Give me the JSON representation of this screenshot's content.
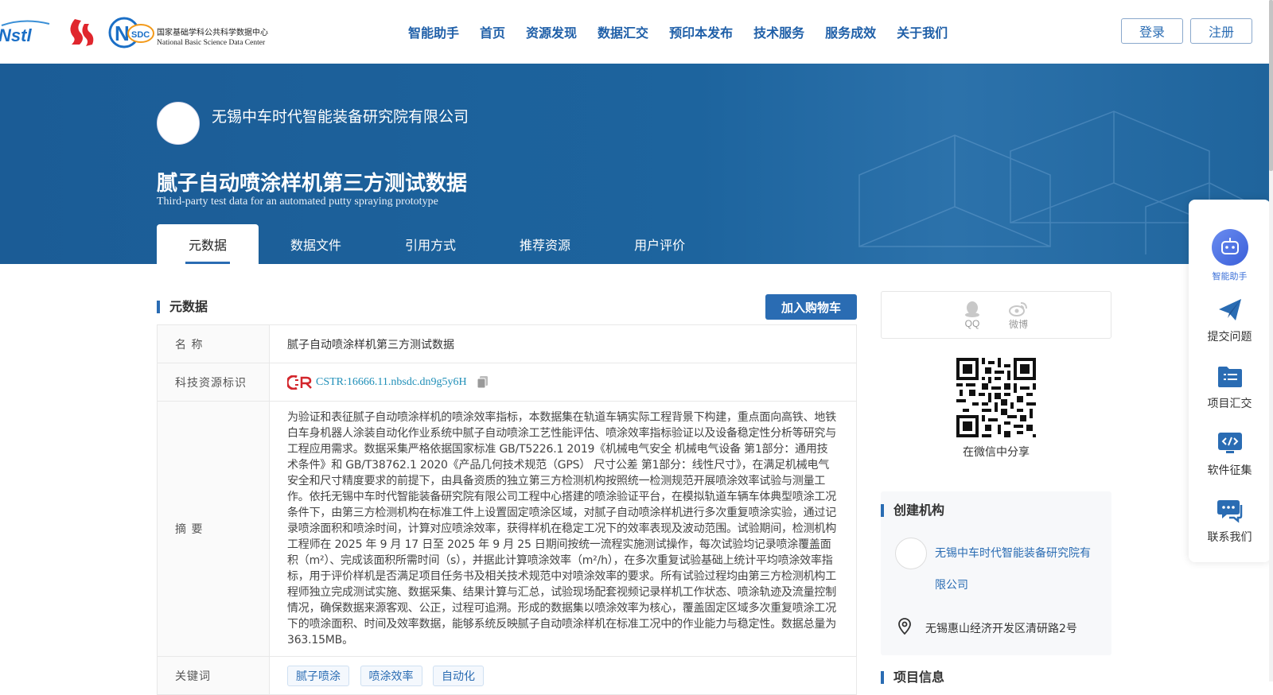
{
  "header": {
    "nav": [
      "智能助手",
      "首页",
      "资源发现",
      "数据汇交",
      "预印本发布",
      "技术服务",
      "服务成效",
      "关于我们"
    ],
    "login_label": "登录",
    "register_label": "注册",
    "logo_text_1": "Nstl",
    "logo_nsdc_cn": "国家基础学科公共科学数据中心",
    "logo_nsdc_en": "National Basic Science Data Center"
  },
  "hero": {
    "org_name": "无锡中车时代智能装备研究院有限公司",
    "title_cn": "腻子自动喷涂样机第三方测试数据",
    "title_en": "Third-party test data for an automated putty spraying prototype",
    "tabs": [
      "元数据",
      "数据文件",
      "引用方式",
      "推荐资源",
      "用户评价"
    ],
    "active_tab": "元数据"
  },
  "metadata": {
    "section_title": "元数据",
    "cart_label": "加入购物车",
    "name_label": "名 称",
    "name_value": "腻子自动喷涂样机第三方测试数据",
    "cstr_label": "科技资源标识",
    "cstr_value": "CSTR:16666.11.nbsdc.dn9g5y6H",
    "abstract_label": "摘 要",
    "abstract_value": "为验证和表征腻子自动喷涂样机的喷涂效率指标，本数据集在轨道车辆实际工程背景下构建，重点面向高铁、地铁白车身机器人涂装自动化作业系统中腻子自动喷涂工艺性能评估、喷涂效率指标验证以及设备稳定性分析等研究与工程应用需求。数据采集严格依据国家标准 GB/T5226.1 2019《机械电气安全 机械电气设备 第1部分：通用技术条件》和 GB/T38762.1 2020《产品几何技术规范（GPS） 尺寸公差 第1部分：线性尺寸》，在满足机械电气安全和尺寸精度要求的前提下，由具备资质的独立第三方检测机构按照统一检测规范开展喷涂效率试验与测量工作。依托无锡中车时代智能装备研究院有限公司工程中心搭建的喷涂验证平台，在模拟轨道车辆车体典型喷涂工况条件下，由第三方检测机构在标准工件上设置固定喷涂区域，对腻子自动喷涂样机进行多次重复喷涂实验，通过记录喷涂面积和喷涂时间，计算对应喷涂效率，获得样机在稳定工况下的效率表现及波动范围。试验期间，检测机构工程师在 2025 年 9 月 17 日至 2025 年 9 月 25 日期间按统一流程实施测试操作，每次试验均记录喷涂覆盖面积（m²）、完成该面积所需时间（s），并据此计算喷涂效率（m²/h），在多次重复试验基础上统计平均喷涂效率指标，用于评价样机是否满足项目任务书及相关技术规范中对喷涂效率的要求。所有试验过程均由第三方检测机构工程师独立完成测试实施、数据采集、结果计算与汇总，试验现场配套视频记录样机工作状态、喷涂轨迹及流量控制情况，确保数据来源客观、公正，过程可追溯。形成的数据集以喷涂效率为核心，覆盖固定区域多次重复喷涂工况下的喷涂面积、时间及效率数据，能够系统反映腻子自动喷涂样机在标准工况中的作业能力与稳定性。数据总量为 363.15MB。",
    "keyword_label": "关键词",
    "keywords": [
      "腻子喷涂",
      "喷涂效率",
      "自动化"
    ]
  },
  "sidebar": {
    "share_qq": "QQ",
    "share_weibo": "微博",
    "qr_caption": "在微信中分享",
    "org_section_title": "创建机构",
    "org_name": "无锡中车时代智能装备研究院有限公司",
    "address": "无锡惠山经济开发区清研路2号",
    "project_section_title": "项目信息"
  },
  "float_menu": {
    "assistant": "智能助手",
    "submit_question": "提交问题",
    "project_collect": "项目汇交",
    "software_collect": "软件征集",
    "contact_us": "联系我们"
  }
}
